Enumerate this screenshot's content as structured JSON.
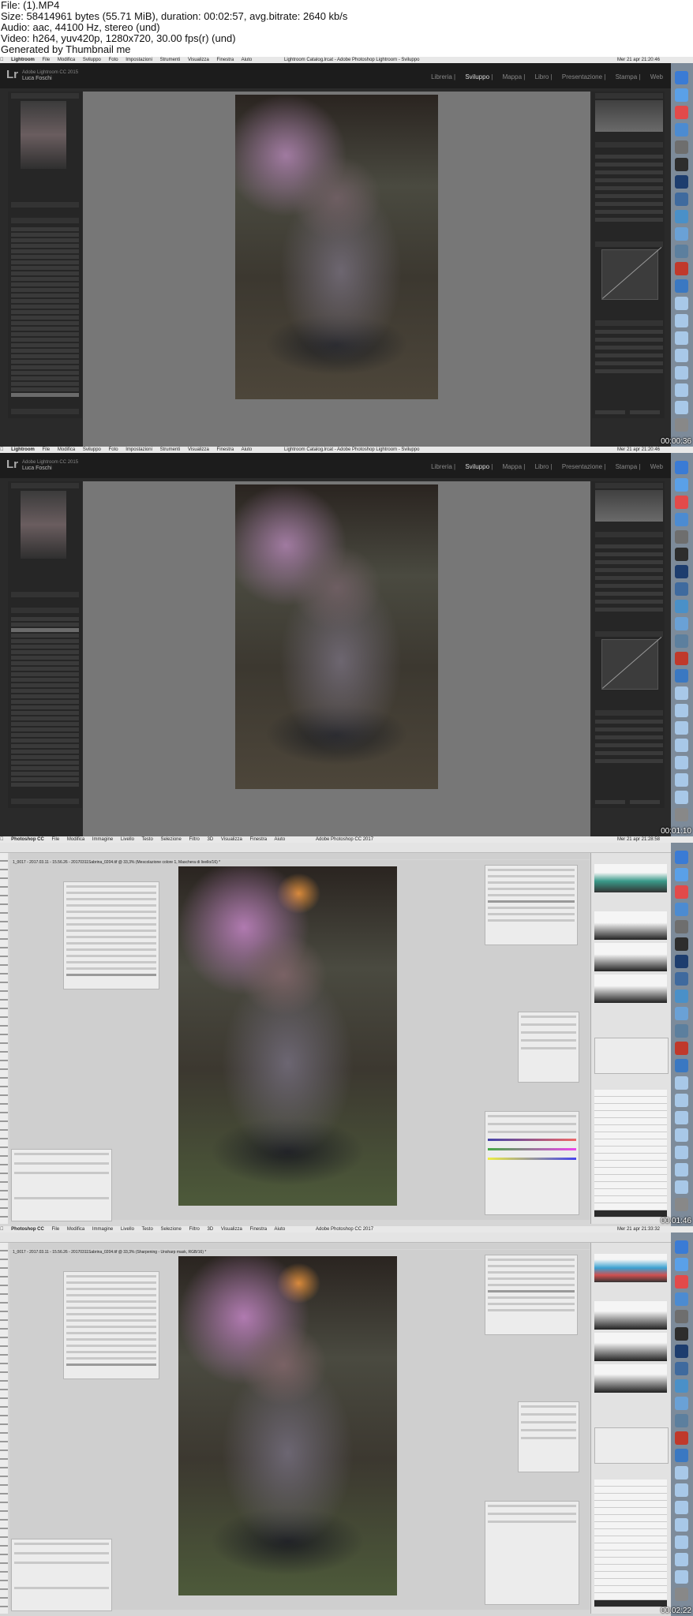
{
  "header": {
    "line1": "File: (1).MP4",
    "line2": "Size: 58414961 bytes (55.71 MiB), duration: 00:02:57, avg.bitrate: 2640 kb/s",
    "line3": "Audio: aac, 44100 Hz, stereo (und)",
    "line4": "Video: h264, yuv420p, 1280x720, 30.00 fps(r) (und)",
    "line5": "Generated by Thumbnail me"
  },
  "frames": [
    {
      "app": "Lightroom",
      "timestamp": "00:00:36",
      "menu": [
        "Lightroom",
        "File",
        "Modifica",
        "Sviluppo",
        "Foto",
        "Impostazioni",
        "Strumenti",
        "Visualizza",
        "Finestra",
        "Aiuto"
      ],
      "window_title": "Lightroom Catalog.lrcat - Adobe Photoshop Lightroom - Sviluppo",
      "clock": "Mer 21 apr 21:20:46",
      "user_line1": "Adobe Lightroom CC 2015",
      "user_line2": "Luca Foschi",
      "modules": [
        "Libreria",
        "Sviluppo",
        "Mappa",
        "Libro",
        "Presentazione",
        "Stampa",
        "Web"
      ],
      "active_module": "Sviluppo"
    },
    {
      "app": "Lightroom",
      "timestamp": "00:01:10",
      "menu": [
        "Lightroom",
        "File",
        "Modifica",
        "Sviluppo",
        "Foto",
        "Impostazioni",
        "Strumenti",
        "Visualizza",
        "Finestra",
        "Aiuto"
      ],
      "window_title": "Lightroom Catalog.lrcat - Adobe Photoshop Lightroom - Sviluppo",
      "clock": "Mer 21 apr 21:20:46",
      "user_line1": "Adobe Lightroom CC 2015",
      "user_line2": "Luca Foschi",
      "modules": [
        "Libreria",
        "Sviluppo",
        "Mappa",
        "Libro",
        "Presentazione",
        "Stampa",
        "Web"
      ],
      "active_module": "Sviluppo"
    },
    {
      "app": "Photoshop",
      "timestamp": "00:01:46",
      "menu": [
        "Photoshop CC",
        "File",
        "Modifica",
        "Immagine",
        "Livello",
        "Testo",
        "Selezione",
        "Filtro",
        "3D",
        "Visualizza",
        "Finestra",
        "Aiuto"
      ],
      "window_title": "Adobe Photoshop CC 2017",
      "clock": "Mer 21 apr 21:28:58",
      "doc_tab": "1_0017 - 2017.03.11 - 15.56.26 - 20170311Sabrina_0204.tif @ 33,3% (Mescolazione colore 1, Maschera di livello/16) *"
    },
    {
      "app": "Photoshop",
      "timestamp": "00:02:22",
      "menu": [
        "Photoshop CC",
        "File",
        "Modifica",
        "Immagine",
        "Livello",
        "Testo",
        "Selezione",
        "Filtro",
        "3D",
        "Visualizza",
        "Finestra",
        "Aiuto"
      ],
      "window_title": "Adobe Photoshop CC 2017",
      "clock": "Mer 21 apr 21:33:32",
      "doc_tab": "1_0017 - 2017.03.11 - 15.56.26 - 20170311Sabrina_0204.tif @ 33,3% (Sharpening - Unsharp mask, RGB/16) *"
    }
  ],
  "colors": {
    "lr_bg": "#2a2a2a",
    "lr_panel": "#262626",
    "ps_bg": "#d6d6d6",
    "dock": "#7d8b9a"
  }
}
